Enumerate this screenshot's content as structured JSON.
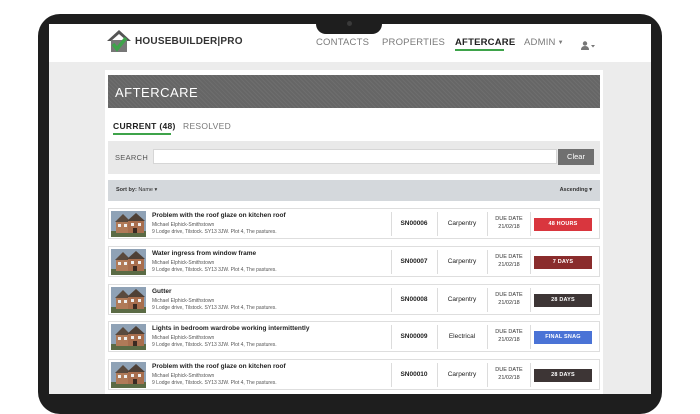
{
  "logo": {
    "text_a": "HOUSEBUILDER",
    "text_b": "PRO"
  },
  "nav": {
    "contacts": "CONTACTS",
    "properties": "PROPERTIES",
    "aftercare": "AFTERCARE",
    "admin": "ADMIN"
  },
  "page_title": "AFTERCARE",
  "tabs": {
    "current": "CURRENT (48)",
    "resolved": "RESOLVED"
  },
  "search": {
    "label": "SEARCH",
    "value": "",
    "clear_label": "Clear"
  },
  "sort": {
    "label": "Sort by:",
    "value": "Name",
    "order": "Ascending"
  },
  "due_label_1": "DUE DATE",
  "colors": {
    "accent": "#3ea34a",
    "red": "#d9363e",
    "brown": "#8a2c2c",
    "dark": "#3d3535",
    "blue": "#4a73d6"
  },
  "rows": [
    {
      "title": "Problem with the roof glaze on kitchen roof",
      "name": "Michael Elphick-Smithstown",
      "address": "9 Lodge drive, Tilstock. SY13 3JW. Plot 4, The pastures.",
      "ref": "SN00006",
      "trade": "Carpentry",
      "due_label": "DUE DATE",
      "due": "21/02/18",
      "status": "48 HOURS",
      "status_color": "#d9363e"
    },
    {
      "title": "Water ingress from window frame",
      "name": "Michael Elphick-Smithstown",
      "address": "9 Lodge drive, Tilstock. SY13 3JW. Plot 4, The pastures.",
      "ref": "SN00007",
      "trade": "Carpentry",
      "due_label": "DUE DATE",
      "due": "21/02/18",
      "status": "7 DAYS",
      "status_color": "#8a2c2c"
    },
    {
      "title": "Gutter",
      "name": "Michael Elphick-Smithstown",
      "address": "9 Lodge drive, Tilstock. SY13 3JW. Plot 4, The pastures.",
      "ref": "SN00008",
      "trade": "Carpentry",
      "due_label": "DUE DATE",
      "due": "21/02/18",
      "status": "28 DAYS",
      "status_color": "#3d3535"
    },
    {
      "title": "Lights in bedroom wardrobe working intermittently",
      "name": "Michael Elphick-Smithstown",
      "address": "9 Lodge drive, Tilstock. SY13 3JW. Plot 4, The pastures.",
      "ref": "SN00009",
      "trade": "Electrical",
      "due_label": "DUE DATE",
      "due": "21/02/18",
      "status": "FINAL SNAG",
      "status_color": "#4a73d6"
    },
    {
      "title": "Problem with the roof glaze on kitchen roof",
      "name": "Michael Elphick-Smithstown",
      "address": "9 Lodge drive, Tilstock. SY13 3JW. Plot 4, The pastures.",
      "ref": "SN00010",
      "trade": "Carpentry",
      "due_label": "DUE DATE",
      "due": "21/02/18",
      "status": "28 DAYS",
      "status_color": "#3d3535"
    }
  ]
}
